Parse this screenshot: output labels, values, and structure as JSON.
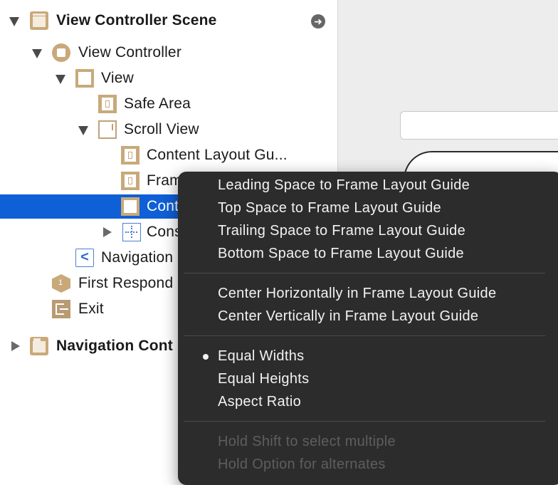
{
  "outline": {
    "rows": [
      {
        "label": "View Controller Scene",
        "icon": "scene-icon"
      },
      {
        "label": "View Controller",
        "icon": "view-controller-icon"
      },
      {
        "label": "View",
        "icon": "view-icon"
      },
      {
        "label": "Safe Area",
        "icon": "layout-guide-icon"
      },
      {
        "label": "Scroll View",
        "icon": "scroll-view-icon"
      },
      {
        "label": "Content Layout Gu...",
        "icon": "layout-guide-icon"
      },
      {
        "label": "Fram",
        "icon": "layout-guide-icon"
      },
      {
        "label": "Cont",
        "icon": "view-icon"
      },
      {
        "label": "Cons",
        "icon": "constraints-icon"
      },
      {
        "label": "Navigation",
        "icon": "navigation-icon"
      },
      {
        "label": "First Respond",
        "icon": "first-responder-icon"
      },
      {
        "label": "Exit",
        "icon": "exit-icon"
      },
      {
        "label": "Navigation Cont",
        "icon": "navigation-scene-icon"
      }
    ],
    "nav_glyph": "<",
    "go_arrow": "➜"
  },
  "menu": {
    "group1": [
      "Leading Space to Frame Layout Guide",
      "Top Space to Frame Layout Guide",
      "Trailing Space to Frame Layout Guide",
      "Bottom Space to Frame Layout Guide"
    ],
    "group2": [
      "Center Horizontally in Frame Layout Guide",
      "Center Vertically in Frame Layout Guide"
    ],
    "group3": [
      "Equal Widths",
      "Equal Heights",
      "Aspect Ratio"
    ],
    "hints": [
      "Hold Shift to select multiple",
      "Hold Option for alternates"
    ],
    "checked_item": "Equal Widths"
  },
  "colors": {
    "selection": "#0f5fd6",
    "menu_background": "#2c2c2c",
    "icon_tan": "#c9a97a",
    "constraint_blue": "#4b7fd1"
  }
}
